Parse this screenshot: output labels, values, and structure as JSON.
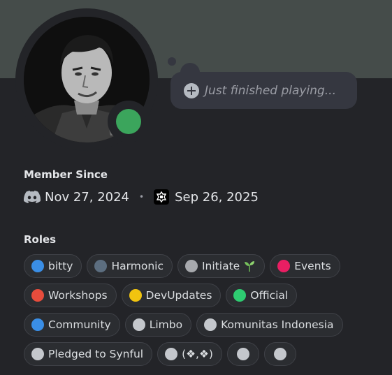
{
  "status": {
    "text": "Just finished playing..."
  },
  "member_since": {
    "title": "Member Since",
    "discord_date": "Nov 27, 2024",
    "separator": "•",
    "server_date": "Sep 26, 2025"
  },
  "roles": {
    "title": "Roles",
    "rows": [
      [
        {
          "label": "bitty",
          "color": "#3a8ee6"
        },
        {
          "label": "Harmonic",
          "color": "#5c6e80"
        },
        {
          "label": "Initiate",
          "color": "#a7a9ad",
          "icon": "sprout-icon"
        },
        {
          "label": "Events",
          "color": "#e91e63"
        }
      ],
      [
        {
          "label": "Workshops",
          "color": "#e74c3c"
        },
        {
          "label": "DevUpdates",
          "color": "#f1c40f"
        },
        {
          "label": "Official",
          "color": "#2ecc71"
        }
      ],
      [
        {
          "label": "Community",
          "color": "#3a8ee6"
        },
        {
          "label": "Limbo",
          "color": "#c4c7cc"
        },
        {
          "label": "Komunitas Indonesia",
          "color": "#c4c7cc"
        }
      ],
      [
        {
          "label": "Pledged to Synful",
          "color": "#c4c7cc"
        },
        {
          "label": "(❖,❖)",
          "color": "#c4c7cc"
        },
        {
          "label": "",
          "color": "#c4c7cc"
        },
        {
          "label": "",
          "color": "#c4c7cc"
        }
      ]
    ]
  }
}
